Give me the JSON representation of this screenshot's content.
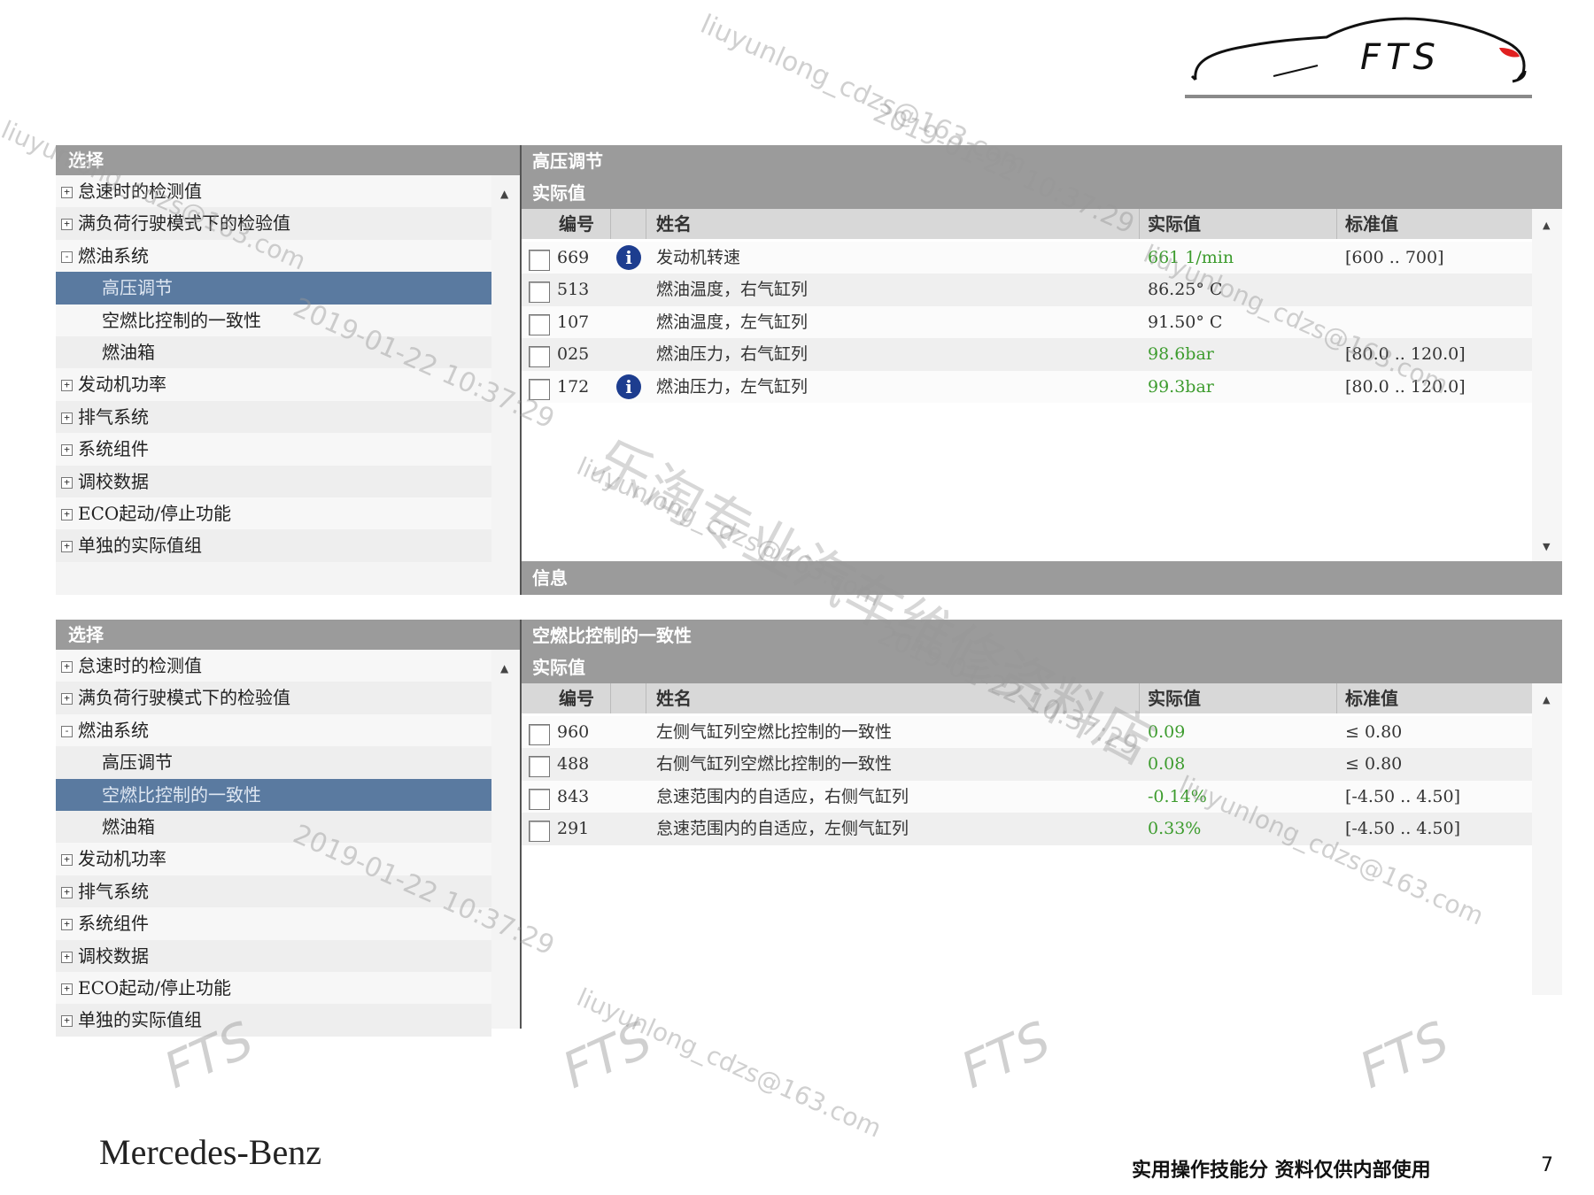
{
  "logo": {
    "text": "FTS"
  },
  "panels": [
    {
      "left_header": "选择",
      "tree": [
        {
          "label": "怠速时的检测值",
          "expander": "+",
          "level": 0,
          "selected": false
        },
        {
          "label": "满负荷行驶模式下的检验值",
          "expander": "+",
          "level": 0,
          "selected": false
        },
        {
          "label": "燃油系统",
          "expander": "-",
          "level": 0,
          "selected": false
        },
        {
          "label": "高压调节",
          "expander": "",
          "level": 1,
          "selected": true
        },
        {
          "label": "空燃比控制的一致性",
          "expander": "",
          "level": 1,
          "selected": false
        },
        {
          "label": "燃油箱",
          "expander": "",
          "level": 1,
          "selected": false
        },
        {
          "label": "发动机功率",
          "expander": "+",
          "level": 0,
          "selected": false
        },
        {
          "label": "排气系统",
          "expander": "+",
          "level": 0,
          "selected": false
        },
        {
          "label": "系统组件",
          "expander": "+",
          "level": 0,
          "selected": false
        },
        {
          "label": "调校数据",
          "expander": "+",
          "level": 0,
          "selected": false
        },
        {
          "label": "ECO起动/停止功能",
          "expander": "+",
          "level": 0,
          "selected": false
        },
        {
          "label": "单独的实际值组",
          "expander": "+",
          "level": 0,
          "selected": false
        }
      ],
      "title": "高压调节",
      "subtitle": "实际值",
      "columns": {
        "id": "编号",
        "name": "姓名",
        "actual": "实际值",
        "standard": "标准值"
      },
      "rows": [
        {
          "id": "669",
          "info": true,
          "name": "发动机转速",
          "actual": "661 1/min",
          "actual_green": true,
          "standard": "[600 .. 700]"
        },
        {
          "id": "513",
          "info": false,
          "name": "燃油温度，右气缸列",
          "actual": "86.25° C",
          "actual_green": false,
          "standard": ""
        },
        {
          "id": "107",
          "info": false,
          "name": "燃油温度，左气缸列",
          "actual": "91.50° C",
          "actual_green": false,
          "standard": ""
        },
        {
          "id": "025",
          "info": false,
          "name": "燃油压力，右气缸列",
          "actual": "98.6bar",
          "actual_green": true,
          "standard": "[80.0 .. 120.0]"
        },
        {
          "id": "172",
          "info": true,
          "name": "燃油压力，左气缸列",
          "actual": "99.3bar",
          "actual_green": true,
          "standard": "[80.0 .. 120.0]"
        }
      ],
      "info_bar": "信息",
      "info_icon": "i"
    },
    {
      "left_header": "选择",
      "tree": [
        {
          "label": "怠速时的检测值",
          "expander": "+",
          "level": 0,
          "selected": false
        },
        {
          "label": "满负荷行驶模式下的检验值",
          "expander": "+",
          "level": 0,
          "selected": false
        },
        {
          "label": "燃油系统",
          "expander": "-",
          "level": 0,
          "selected": false
        },
        {
          "label": "高压调节",
          "expander": "",
          "level": 1,
          "selected": false
        },
        {
          "label": "空燃比控制的一致性",
          "expander": "",
          "level": 1,
          "selected": true
        },
        {
          "label": "燃油箱",
          "expander": "",
          "level": 1,
          "selected": false
        },
        {
          "label": "发动机功率",
          "expander": "+",
          "level": 0,
          "selected": false
        },
        {
          "label": "排气系统",
          "expander": "+",
          "level": 0,
          "selected": false
        },
        {
          "label": "系统组件",
          "expander": "+",
          "level": 0,
          "selected": false
        },
        {
          "label": "调校数据",
          "expander": "+",
          "level": 0,
          "selected": false
        },
        {
          "label": "ECO起动/停止功能",
          "expander": "+",
          "level": 0,
          "selected": false
        },
        {
          "label": "单独的实际值组",
          "expander": "+",
          "level": 0,
          "selected": false
        }
      ],
      "title": "空燃比控制的一致性",
      "subtitle": "实际值",
      "columns": {
        "id": "编号",
        "name": "姓名",
        "actual": "实际值",
        "standard": "标准值"
      },
      "rows": [
        {
          "id": "960",
          "info": false,
          "name": "左侧气缸列空燃比控制的一致性",
          "actual": "0.09",
          "actual_green": true,
          "standard": "≤ 0.80"
        },
        {
          "id": "488",
          "info": false,
          "name": "右侧气缸列空燃比控制的一致性",
          "actual": "0.08",
          "actual_green": true,
          "standard": "≤ 0.80"
        },
        {
          "id": "843",
          "info": false,
          "name": "怠速范围内的自适应，右侧气缸列",
          "actual": "-0.14%",
          "actual_green": true,
          "standard": "[-4.50 .. 4.50]"
        },
        {
          "id": "291",
          "info": false,
          "name": "怠速范围内的自适应，左侧气缸列",
          "actual": "0.33%",
          "actual_green": true,
          "standard": "[-4.50 .. 4.50]"
        }
      ],
      "info_bar": "",
      "info_icon": "i"
    }
  ],
  "watermarks": {
    "email": "liuyunlong_cdzs@163.com",
    "timestamp": "2019-01-22 10:37:29",
    "shop": "乐淘专业汽车维修资料店",
    "mark": "FTS"
  },
  "footer": {
    "brand": "Mercedes-Benz",
    "note": "实用操作技能分 资料仅供内部使用",
    "page": "7"
  },
  "colors": {
    "header_gray": "#9b9b9b",
    "selected_blue": "#5a7aa0",
    "value_green": "#3d9c2e",
    "info_blue": "#1d3d8f",
    "logo_red": "#e02020"
  }
}
